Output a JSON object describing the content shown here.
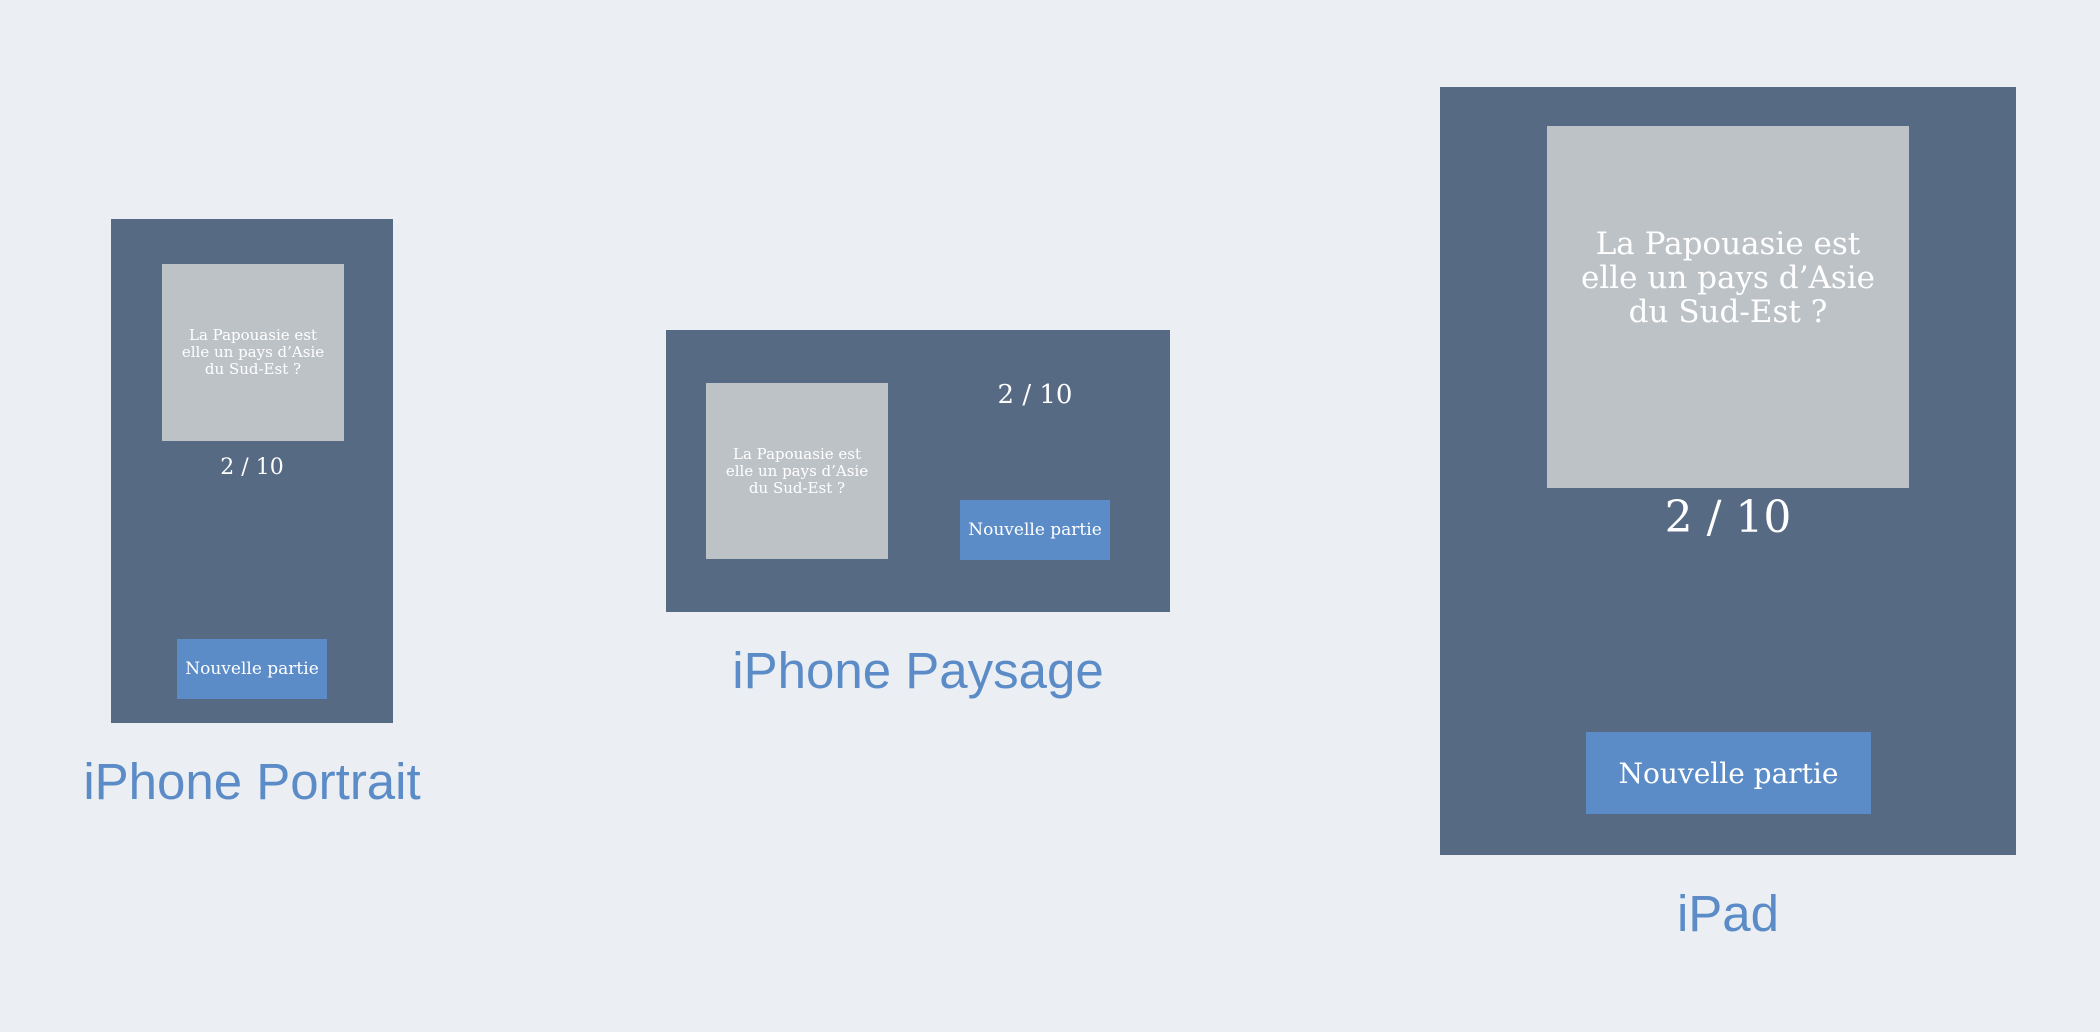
{
  "question": "La Papouasie est\nelle un pays d’Asie\ndu Sud-Est ?",
  "score": "2 / 10",
  "new_game_label": "Nouvelle partie",
  "captions": {
    "portrait": "iPhone Portrait",
    "landscape": "iPhone Paysage",
    "ipad": "iPad"
  },
  "colors": {
    "page_background": "#ebeef2",
    "device_background": "#566a84",
    "card_background": "#bdc2c7",
    "accent": "#5b8cc7",
    "text_on_dark": "#ffffff"
  }
}
